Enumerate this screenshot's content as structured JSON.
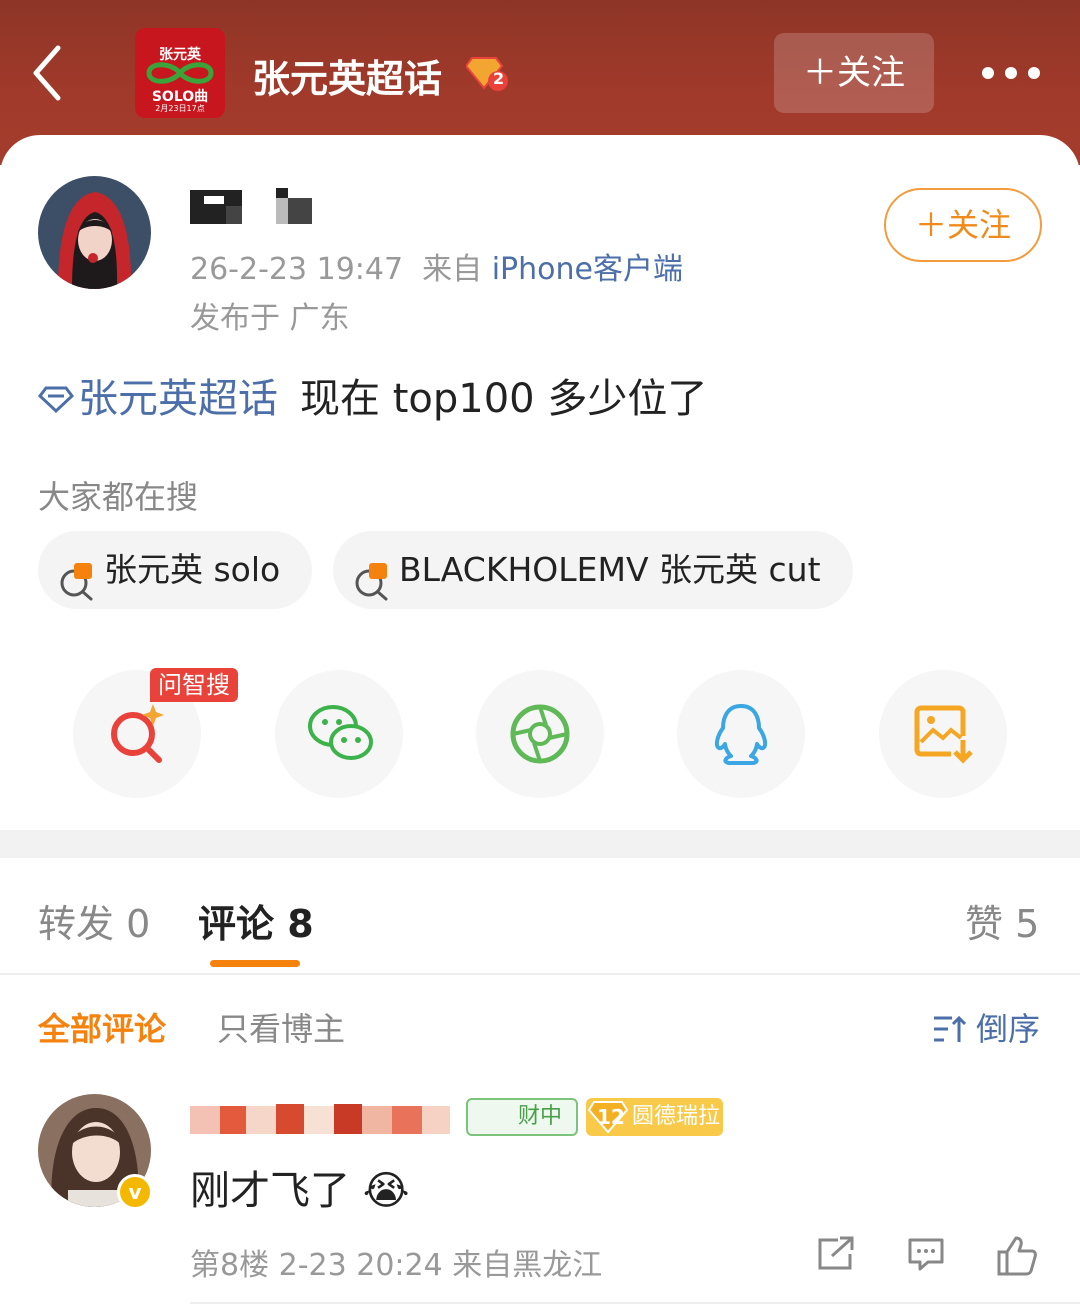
{
  "header": {
    "logo": {
      "line1": "张元英",
      "line2": "SOLO曲",
      "line3": "2月23日17点"
    },
    "title": "张元英超话",
    "level": "2",
    "follow_label": "＋关注"
  },
  "post": {
    "timestamp": "26-2-23 19:47",
    "from_prefix": "来自",
    "device": "iPhone客户端",
    "location": "发布于 广东",
    "follow_label": "＋关注",
    "topic": "张元英超话",
    "text": "现在 top100 多少位了"
  },
  "search": {
    "title": "大家都在搜",
    "chips": [
      {
        "text": "张元英 solo"
      },
      {
        "text": "BLACKHOLEMV 张元英 cut"
      }
    ]
  },
  "share": {
    "ask_badge": "问智搜",
    "icons": [
      "ai-search-icon",
      "wechat-icon",
      "moments-icon",
      "qq-icon",
      "save-image-icon"
    ]
  },
  "tabs": {
    "repost": "转发 0",
    "comments": "评论 8",
    "likes": "赞 5"
  },
  "filters": {
    "all": "全部评论",
    "author_only": "只看博主",
    "sort": "倒序"
  },
  "comment": {
    "v_badge": "v",
    "tag_wealth": "财中",
    "tag_level": "12",
    "tag_name": "圆德瑞拉",
    "text": "刚才飞了 😭",
    "meta": "第8楼  2-23 20:24  来自黑龙江"
  },
  "colors": {
    "header_bg": "#a23a2b",
    "accent_orange": "#f5820c",
    "link_blue": "#4d6fa9"
  }
}
